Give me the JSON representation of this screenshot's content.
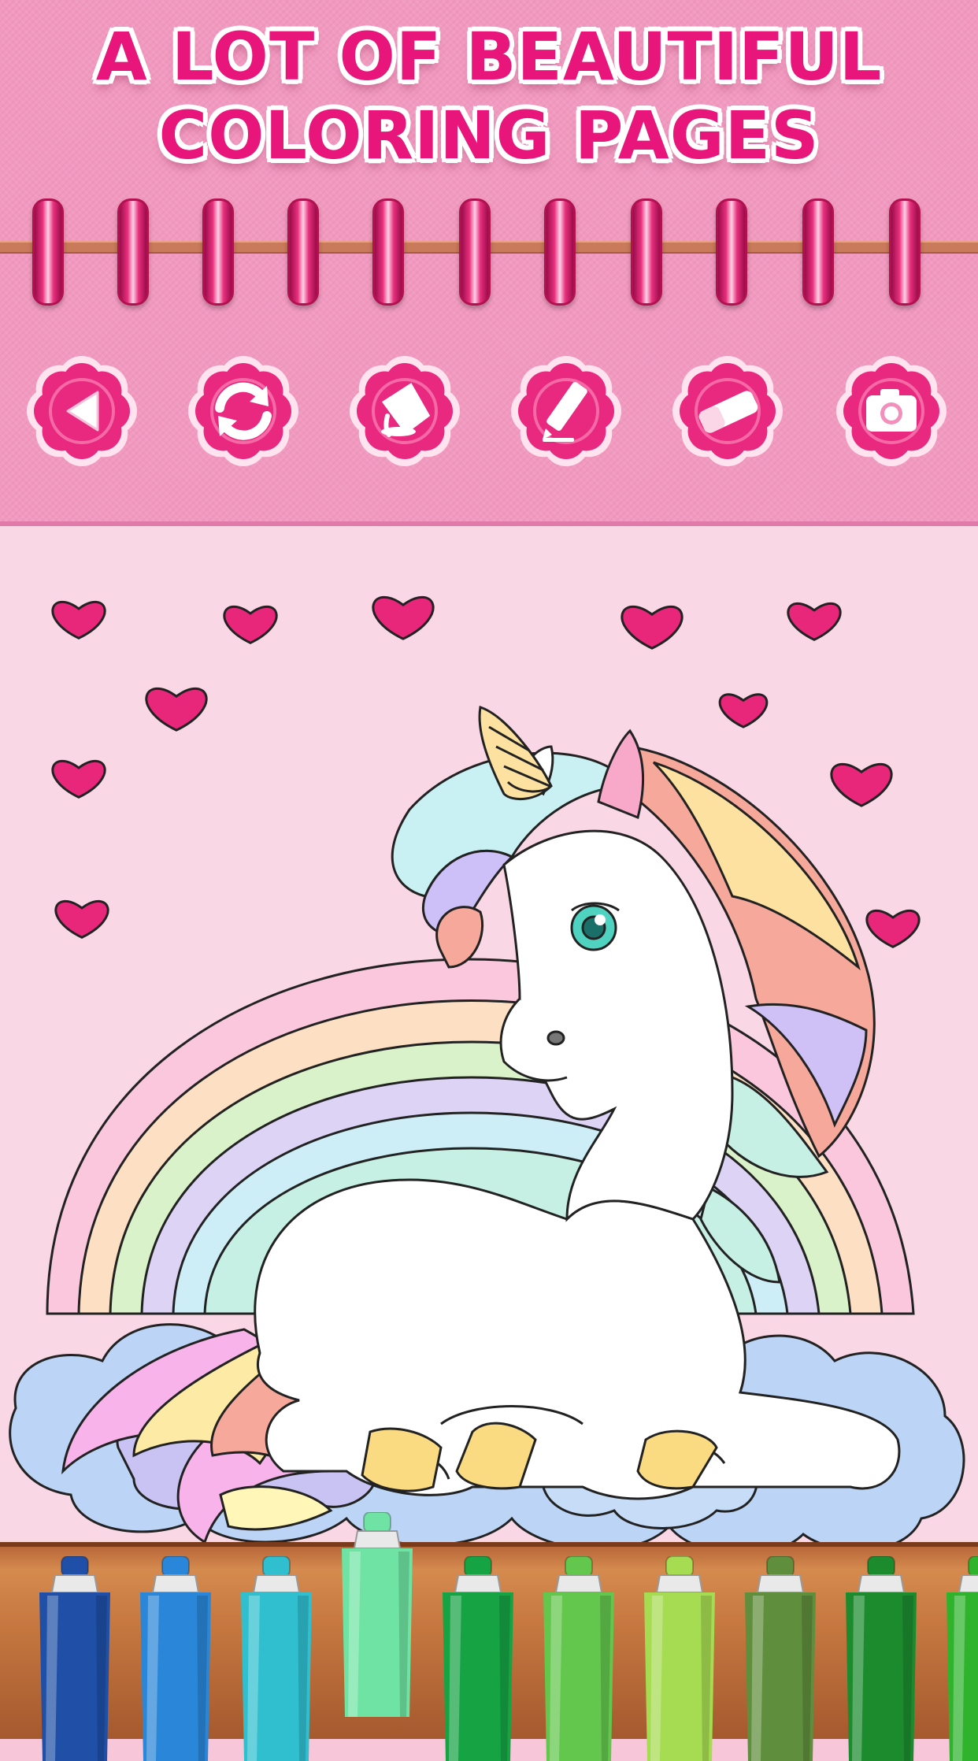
{
  "promo": {
    "line1": "A LOT OF BEAUTIFUL",
    "line2": "COLORING PAGES"
  },
  "toolbar": [
    {
      "name": "back-button",
      "icon": "back-arrow-icon"
    },
    {
      "name": "reset-button",
      "icon": "refresh-icon"
    },
    {
      "name": "fill-button",
      "icon": "paint-bucket-icon"
    },
    {
      "name": "marker-button",
      "icon": "marker-icon"
    },
    {
      "name": "eraser-button",
      "icon": "eraser-icon"
    },
    {
      "name": "camera-button",
      "icon": "camera-icon"
    }
  ],
  "colors": {
    "header_pink": "#f19ac0",
    "title_magenta": "#e8157a",
    "button_magenta": "#e8297f",
    "heart_pink": "#e8277a",
    "page_pink": "#f9d7e5"
  },
  "palette": [
    {
      "name": "navy-blue",
      "color": "#1f4fa6",
      "selected": false
    },
    {
      "name": "sky-blue",
      "color": "#2a86d8",
      "selected": false
    },
    {
      "name": "turquoise",
      "color": "#30bfcf",
      "selected": false
    },
    {
      "name": "mint-green",
      "color": "#6fe3a3",
      "selected": true
    },
    {
      "name": "green",
      "color": "#16a344",
      "selected": false
    },
    {
      "name": "light-green",
      "color": "#63c64d",
      "selected": false
    },
    {
      "name": "lime",
      "color": "#a6dc52",
      "selected": false
    },
    {
      "name": "olive",
      "color": "#5f8e3c",
      "selected": false
    },
    {
      "name": "dark-green",
      "color": "#1c8b2e",
      "selected": false
    },
    {
      "name": "grass-green",
      "color": "#2fb32d",
      "selected": false
    }
  ]
}
